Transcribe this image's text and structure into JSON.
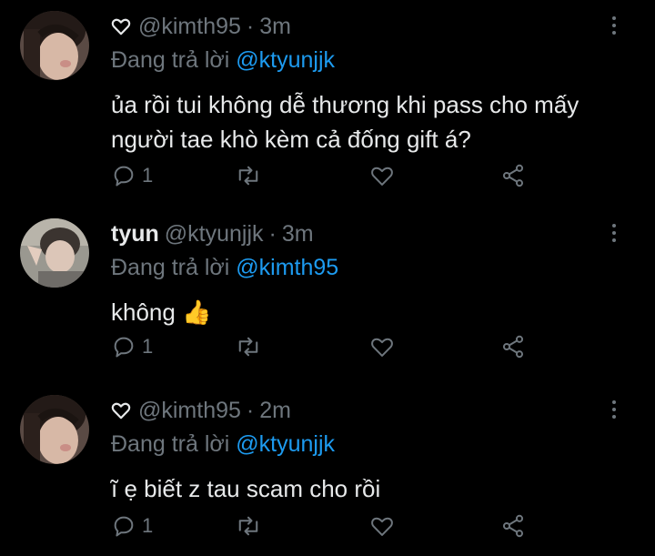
{
  "tweets": [
    {
      "display_name": "",
      "name_icon": "heart-outline-icon",
      "handle": "@kimth95",
      "separator": "·",
      "time": "3m",
      "reply_label": "Đang trả lời",
      "reply_to": "@ktyunjjk",
      "text": "ủa rồi tui không dễ thương khi pass cho mấy người tae khò kèm cả đống gift á?",
      "reply_count": "1",
      "retweet_count": "",
      "like_count": ""
    },
    {
      "display_name": "tyun",
      "name_icon": "",
      "handle": "@ktyunjjk",
      "separator": "·",
      "time": "3m",
      "reply_label": "Đang trả lời",
      "reply_to": "@kimth95",
      "text": "không 👍",
      "reply_count": "1",
      "retweet_count": "",
      "like_count": ""
    },
    {
      "display_name": "",
      "name_icon": "heart-outline-icon",
      "handle": "@kimth95",
      "separator": "·",
      "time": "2m",
      "reply_label": "Đang trả lời",
      "reply_to": "@ktyunjjk",
      "text": "ĩ ẹ biết z tau scam cho rồi",
      "reply_count": "1",
      "retweet_count": "",
      "like_count": ""
    }
  ],
  "colors": {
    "background": "#000000",
    "text": "#e7e9ea",
    "muted": "#6e767d",
    "link": "#1d9bf0"
  },
  "icons": {
    "reply": "reply-bubble-icon",
    "retweet": "retweet-icon",
    "like": "heart-icon",
    "share": "share-icon",
    "more": "more-vertical-icon"
  }
}
